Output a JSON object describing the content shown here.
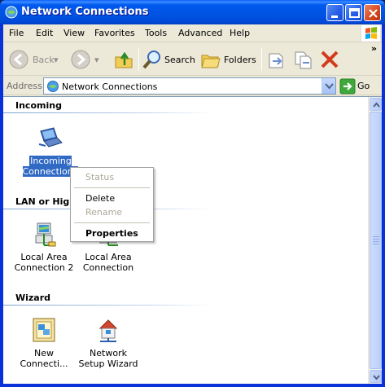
{
  "window": {
    "title": "Network Connections"
  },
  "menu": {
    "items": [
      "File",
      "Edit",
      "View",
      "Favorites",
      "Tools",
      "Advanced",
      "Help"
    ]
  },
  "toolbar": {
    "back_label": "Back",
    "search_label": "Search",
    "folders_label": "Folders",
    "more": "»"
  },
  "address": {
    "label": "Address",
    "value": "Network Connections",
    "go_label": "Go"
  },
  "groups": {
    "incoming": "Incoming",
    "lan": "LAN or High-",
    "wizard": "Wizard"
  },
  "items": {
    "incoming_connections": "Incoming Connections",
    "lan2": "Local Area Connection 2",
    "lan1": "Local Area Connection",
    "new_connection": "New Connecti...",
    "network_setup": "Network Setup Wizard"
  },
  "context_menu": {
    "status": "Status",
    "delete": "Delete",
    "rename": "Rename",
    "properties": "Properties"
  },
  "colors": {
    "titlebar": "#0054e3",
    "selection": "#316ac5",
    "close_button": "#d5471c",
    "face": "#ece9d8"
  }
}
